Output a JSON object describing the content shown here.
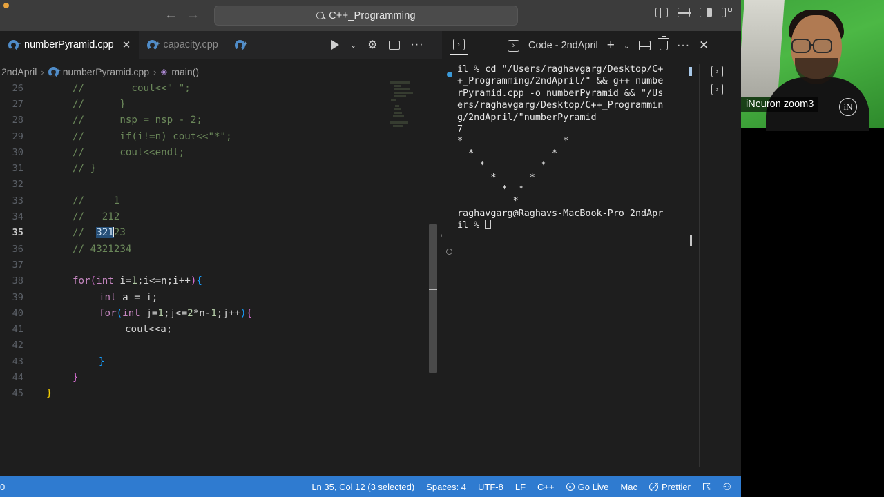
{
  "titlebar": {
    "back_icon": "arrow-left-icon",
    "forward_icon": "arrow-right-icon",
    "search_value": "C++_Programming",
    "search_placeholder": "Search",
    "layout_icons": [
      "panel-left-icon",
      "panel-bottom-icon",
      "panel-right-icon",
      "customize-layout-icon"
    ]
  },
  "tabs": [
    {
      "label": "numberPyramid.cpp",
      "active": true,
      "close": "✕"
    },
    {
      "label": "capacity.cpp",
      "active": false
    },
    {
      "label": "",
      "active": false
    }
  ],
  "tab_actions": {
    "run_icon": "run-play-icon",
    "chevron": "⌄",
    "gear_icon": "gear-icon",
    "split_icon": "split-editor-icon",
    "more_icon": "···"
  },
  "breadcrumb": {
    "folder": "2ndApril",
    "file": "numberPyramid.cpp",
    "symbol": "main()",
    "separator": "›"
  },
  "editor": {
    "lines": [
      {
        "n": "26",
        "html": "<span class='cm'>//        cout&lt;&lt;\" \";</span>"
      },
      {
        "n": "27",
        "html": "<span class='cm'>//      }</span>"
      },
      {
        "n": "28",
        "html": "<span class='cm'>//      nsp = nsp - 2;</span>"
      },
      {
        "n": "29",
        "html": "<span class='cm'>//      if(i!=n) cout&lt;&lt;\"*\";</span>"
      },
      {
        "n": "30",
        "html": "<span class='cm'>//      cout&lt;&lt;endl;</span>"
      },
      {
        "n": "31",
        "html": "<span class='cm'>// }</span>"
      },
      {
        "n": "32",
        "html": ""
      },
      {
        "n": "33",
        "html": "<span class='cm'>//     1</span>"
      },
      {
        "n": "34",
        "html": "<span class='cm'>//   212</span>"
      },
      {
        "n": "35",
        "html": "<span class='cm'>//  </span><span class='sel'>321</span><span class='caret'></span><span class='cm'>23</span>",
        "current": true
      },
      {
        "n": "36",
        "html": "<span class='cm'>// 4321234</span>"
      },
      {
        "n": "37",
        "html": ""
      },
      {
        "n": "38",
        "html": "<span class='kw'>for</span><span class='br2'>(</span><span class='kw'>int</span> i=<span class='num'>1</span>;i&lt;=n;i++<span class='br2'>)</span><span class='br3'>{</span>"
      },
      {
        "n": "39",
        "html": "<span class='kw'>int</span> a = i;"
      },
      {
        "n": "40",
        "html": "<span class='kw'>for</span><span class='br3'>(</span><span class='kw'>int</span> j=<span class='num'>1</span>;j&lt;=<span class='num'>2</span>*n-<span class='num'>1</span>;j++<span class='br3'>)</span><span class='br2'>{</span>"
      },
      {
        "n": "41",
        "html": "cout&lt;&lt;a;"
      },
      {
        "n": "42",
        "html": ""
      },
      {
        "n": "43",
        "html": "<span class='br3'>}</span>"
      },
      {
        "n": "44",
        "html": "<span class='br2'>}</span>"
      },
      {
        "n": "45",
        "html": "<span class='br1'>}</span>"
      }
    ]
  },
  "terminal_bar": {
    "toggle_icon": "terminal-icon",
    "tab_label": "Code - 2ndApril",
    "tab_icon": "terminal-icon",
    "new_icon": "+",
    "chevron": "⌄",
    "split_icon": "split-terminal-icon",
    "kill_icon": "trash-icon",
    "more_icon": "···",
    "close_icon": "✕"
  },
  "terminal": {
    "command_lines": [
      "il % cd \"/Users/raghavgarg/Desktop/C+",
      "+_Programming/2ndApril/\" && g++ numbe",
      "rPyramid.cpp -o numberPyramid && \"/Us",
      "ers/raghavgarg/Desktop/C++_Programmin",
      "g/2ndApril/\"numberPyramid"
    ],
    "input_value": "7",
    "pattern_lines": [
      "*             *",
      "  *         *",
      "    *     *",
      "      * *",
      "        *"
    ],
    "pattern_full": [
      "*                  *",
      "  *              *",
      "    *          *",
      "      *      *",
      "        *  *",
      "          *"
    ],
    "prompt_line": "raghavgarg@Raghavs-MacBook-Pro 2ndApr",
    "prompt_tail": "il % ",
    "cursor": "block"
  },
  "side_icons": [
    "terminal-icon",
    "terminal-icon"
  ],
  "status": {
    "left_text": "0",
    "items": [
      {
        "name": "cursor-position",
        "label": "Ln 35, Col 12 (3 selected)"
      },
      {
        "name": "indentation",
        "label": "Spaces: 4"
      },
      {
        "name": "encoding",
        "label": "UTF-8"
      },
      {
        "name": "eol",
        "label": "LF"
      },
      {
        "name": "language-mode",
        "label": "C++"
      },
      {
        "name": "go-live",
        "label": "Go Live",
        "icon": "broadcast-icon"
      },
      {
        "name": "platform",
        "label": "Mac"
      },
      {
        "name": "prettier",
        "label": "Prettier",
        "icon": "no-entry-icon"
      }
    ],
    "feedback_icon": "feedback-icon",
    "bell_icon": "🔔",
    "accent_color": "#2f7bd0"
  },
  "webcam": {
    "label": "iNeuron zoom3",
    "logo_text": "iN"
  },
  "colors": {
    "editor_bg": "#1e1e1e",
    "tabbar_bg": "#252526",
    "titlebar_bg": "#3c3c3c",
    "status_bg": "#2f7bd0",
    "comment_green": "#6a8759",
    "selection_blue": "#264f78"
  }
}
